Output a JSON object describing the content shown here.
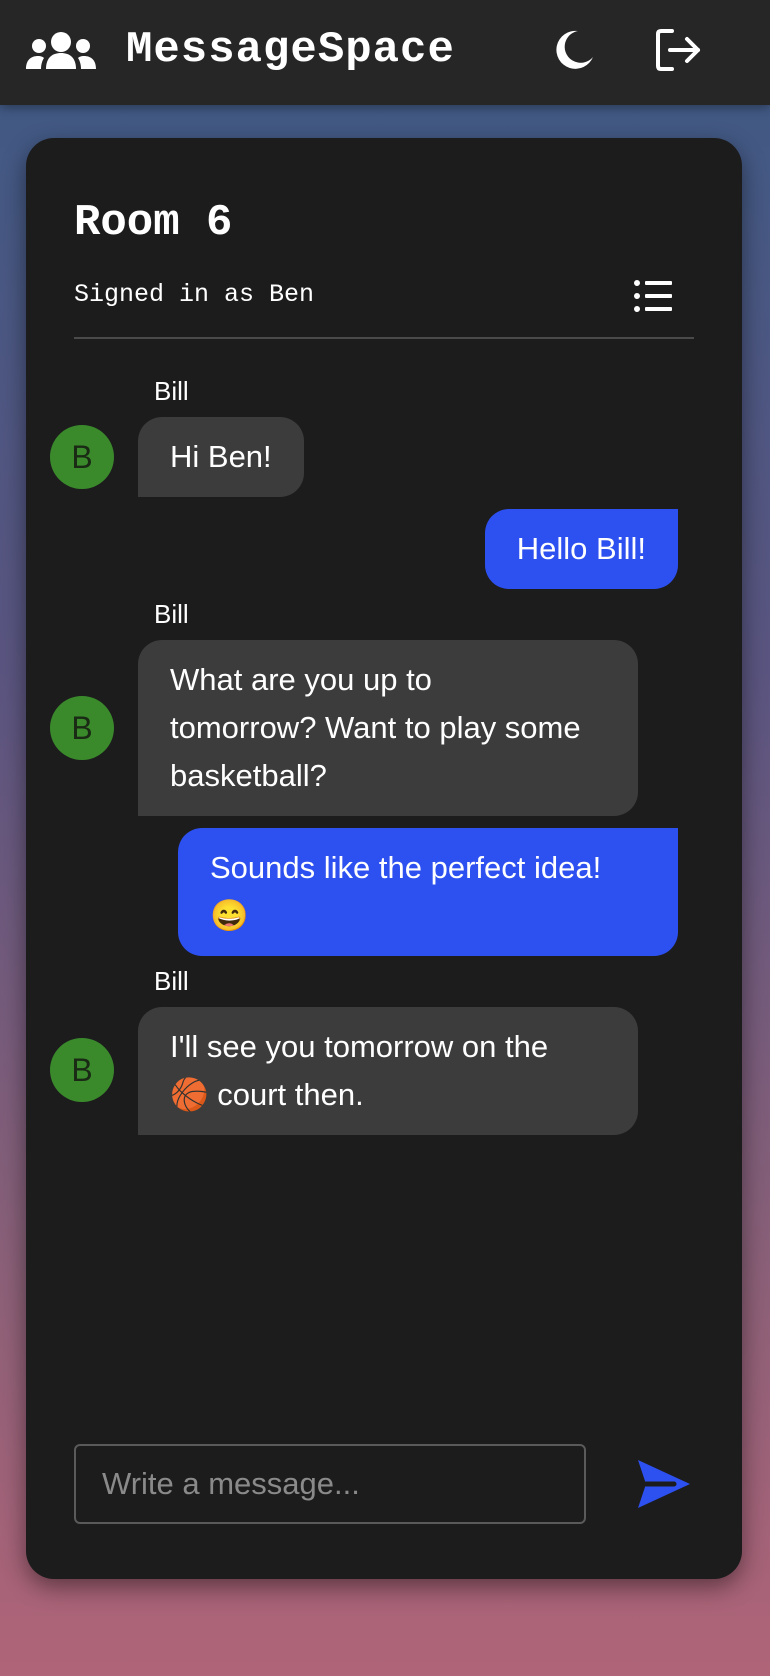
{
  "app": {
    "title": "MessageSpace",
    "brand_icon": "users-icon",
    "theme_icon": "moon-icon",
    "logout_icon": "logout-icon"
  },
  "room": {
    "title": "Room 6",
    "signed_in": "Signed in as Ben",
    "menu_icon": "list-icon"
  },
  "messages": [
    {
      "direction": "incoming",
      "sender": "Bill",
      "avatar": "B",
      "lines": [
        "Hi Ben!"
      ]
    },
    {
      "direction": "outgoing",
      "lines": [
        "Hello Bill!"
      ]
    },
    {
      "direction": "incoming",
      "sender": "Bill",
      "avatar": "B",
      "lines": [
        "What are you up to",
        "tomorrow? Want to play some",
        "basketball?"
      ]
    },
    {
      "direction": "outgoing",
      "lines": [
        "Sounds like the perfect idea!",
        "😄"
      ]
    },
    {
      "direction": "incoming",
      "sender": "Bill",
      "avatar": "B",
      "lines": [
        "I'll see you tomorrow on the",
        "🏀 court then."
      ]
    }
  ],
  "composer": {
    "placeholder": "Write a message...",
    "value": "",
    "send_icon": "send-icon"
  },
  "colors": {
    "header_bg": "#262626",
    "card_bg": "#1c1c1c",
    "incoming_bubble": "#3c3c3c",
    "outgoing_bubble": "#2d50f0",
    "avatar_bg": "#3a8a2c",
    "send_accent": "#2d50f0"
  }
}
